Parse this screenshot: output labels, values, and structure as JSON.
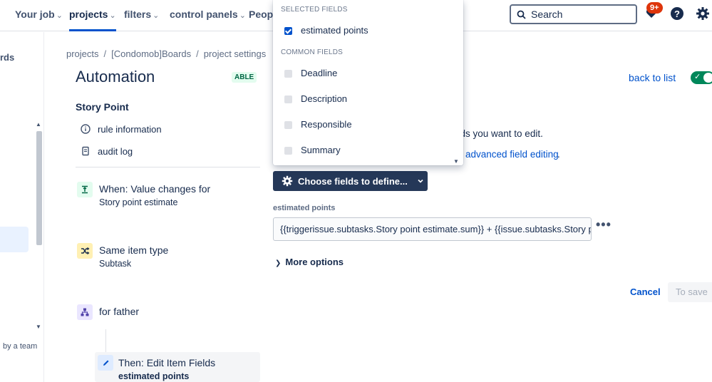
{
  "topnav": {
    "your_job": "Your job",
    "projects": "projects",
    "filters": "filters",
    "control_panels": "control panels",
    "people": "Peopl",
    "search_label": "Search",
    "notifications_badge": "9+"
  },
  "rail": {
    "boards_text": "rds",
    "footer_text": "by a team"
  },
  "breadcrumb": {
    "items": [
      "projects",
      "[Condomob]Boards",
      "project settings"
    ],
    "separator": "/"
  },
  "page": {
    "title": "Automation",
    "status_lozenge": "ABLE",
    "back_link": "back to list",
    "toggle_check": "✓"
  },
  "rule": {
    "name": "Story Point",
    "links": [
      "rule information",
      "audit log"
    ],
    "steps": [
      {
        "title": "When: Value changes for",
        "subtitle": "Story point estimate"
      },
      {
        "title": "Same item type",
        "subtitle": "Subtask"
      },
      {
        "title": "for father",
        "subtitle": ""
      },
      {
        "title": "Then: Edit Item Fields",
        "subtitle": "estimated points"
      }
    ]
  },
  "editor": {
    "info_text": "elds you want to edit.",
    "advanced_link": "advanced field editing",
    "advanced_suffix": ".",
    "choose_button": "Choose fields to define...",
    "field_label": "estimated points",
    "field_value": "{{triggerissue.subtasks.Story point estimate.sum}} +  {{issue.subtasks.Story p",
    "more_dots": "•••",
    "more_options": "More options",
    "cancel": "Cancel",
    "save": "To save"
  },
  "dropdown": {
    "selected_header": "SELECTED FIELDS",
    "selected": [
      {
        "label": "estimated points",
        "checked": true
      }
    ],
    "common_header": "COMMON FIELDS",
    "common": [
      {
        "label": "Deadline",
        "checked": false
      },
      {
        "label": "Description",
        "checked": false
      },
      {
        "label": "Responsible",
        "checked": false
      },
      {
        "label": "Summary",
        "checked": false
      }
    ]
  },
  "colors": {
    "primary": "#0052cc",
    "dark_button": "#253858",
    "toggle_on": "#00875a",
    "badge": "#de350b"
  }
}
